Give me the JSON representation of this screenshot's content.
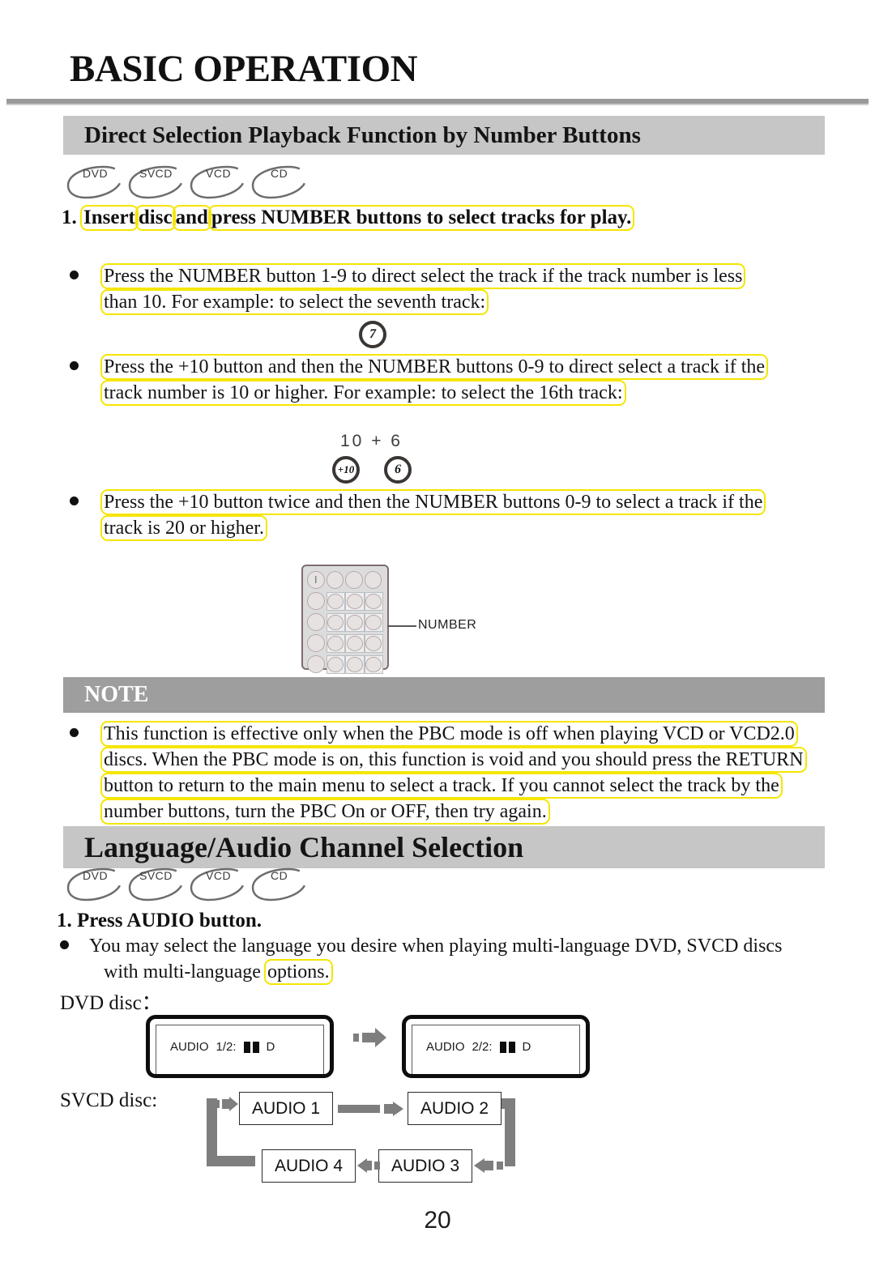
{
  "header": {
    "title": "BASIC OPERATION"
  },
  "section1": {
    "heading": "Direct Selection Playback Function by Number Buttons",
    "disc_badges": [
      "DVD",
      "SVCD",
      "VCD",
      "CD"
    ],
    "step": "1. Insert disc and press NUMBER buttons to select tracks for play.",
    "step_parts": [
      "1.",
      "Insert",
      "disc",
      "and",
      "press NUMBER buttons to select tracks for play."
    ],
    "bullets": [
      {
        "lines": [
          "Press the NUMBER button 1-9 to direct select the track if the track number is less",
          "than 10. For example: to select the seventh track:"
        ],
        "key_example": {
          "keys": [
            "7"
          ]
        }
      },
      {
        "lines": [
          "Press the +10 button and then the NUMBER buttons 0-9 to direct select a track if the",
          "track number is 10 or higher. For example: to select the 16th track:"
        ],
        "key_example": {
          "label": "10 + 6",
          "keys": [
            "+10",
            "6"
          ]
        }
      },
      {
        "lines": [
          "Press the +10 button twice and then the NUMBER buttons 0-9 to select a track if the",
          "track is 20 or higher."
        ]
      }
    ],
    "remote": {
      "callout_label": "NUMBER",
      "power_icon": "power-icon"
    }
  },
  "note": {
    "heading": "NOTE",
    "lines": [
      "This function is effective only when the PBC mode is off when playing VCD or VCD2.0",
      "discs. When the PBC mode is on, this function is void and you should press the RETURN",
      "button to return to the main menu to select a track. If you cannot select the track by the",
      "number buttons, turn the PBC On or OFF, then try again."
    ]
  },
  "section2": {
    "heading": "Language/Audio Channel Selection",
    "disc_badges": [
      "DVD",
      "SVCD",
      "VCD",
      "CD"
    ],
    "step": "1. Press AUDIO button.",
    "bullet_lines": [
      "You may select the language you desire when playing multi-language DVD, SVCD discs",
      "with multi-language options."
    ],
    "dvd_label": "DVD disc：",
    "svcd_label": "SVCD disc:",
    "osd": [
      {
        "label": "AUDIO",
        "value": "1/2:",
        "logo": "dolby-digital-logo",
        "suffix": "D"
      },
      {
        "label": "AUDIO",
        "value": "2/2:",
        "logo": "dolby-digital-logo",
        "suffix": "D"
      }
    ],
    "cycle": [
      "AUDIO 1",
      "AUDIO 2",
      "AUDIO 3",
      "AUDIO 4"
    ]
  },
  "footer": {
    "page_number": "20"
  },
  "colors": {
    "band_light": "#c6c6c6",
    "band_dark": "#9e9e9e",
    "highlight": "#f5e600",
    "arrow_gray": "#7e7e7e",
    "rule": "#9a9a9a"
  }
}
